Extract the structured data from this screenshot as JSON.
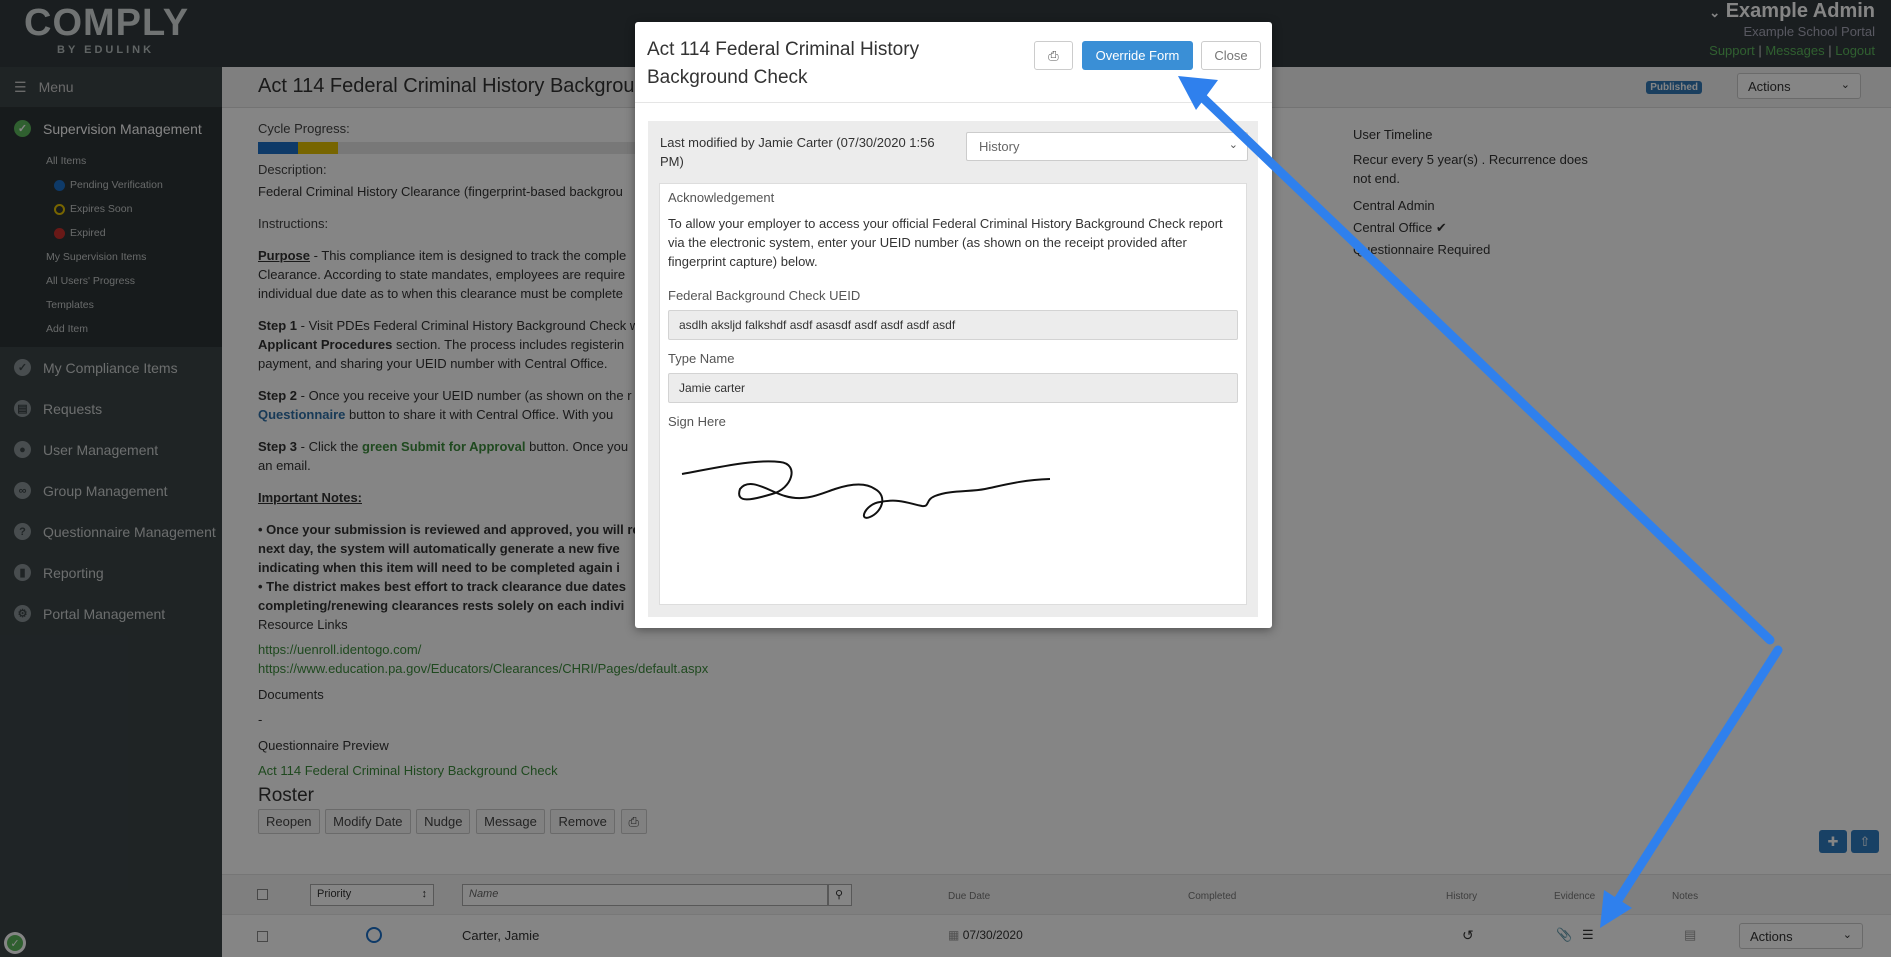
{
  "header": {
    "logo": "COMPLY",
    "logo_by": "BY EDULINK",
    "user_name": "Example Admin",
    "portal_name": "Example School Portal",
    "links": [
      "Support",
      "Messages",
      "Logout"
    ],
    "separator": "|"
  },
  "sidebar": {
    "menu_label": "Menu",
    "items": [
      {
        "label": "Supervision Management",
        "icon": "check-circle-icon"
      },
      {
        "label": "My Compliance Items",
        "icon": "check-circle-icon"
      },
      {
        "label": "Requests",
        "icon": "document-icon"
      },
      {
        "label": "User Management",
        "icon": "user-icon"
      },
      {
        "label": "Group Management",
        "icon": "group-icon"
      },
      {
        "label": "Questionnaire Management",
        "icon": "question-icon"
      },
      {
        "label": "Reporting",
        "icon": "chart-icon"
      },
      {
        "label": "Portal Management",
        "icon": "gear-icon"
      }
    ],
    "sub_items": {
      "all_items": "All Items",
      "pending": "Pending Verification",
      "expires_soon": "Expires Soon",
      "expired": "Expired",
      "my_supervision": "My Supervision Items",
      "all_users_progress": "All Users' Progress",
      "templates": "Templates",
      "add_item": "Add Item"
    },
    "colors": {
      "pending": "#1b6fc7",
      "expires_soon": "#e5c100",
      "expired": "#c9302c"
    }
  },
  "main": {
    "title": "Act 114 Federal Criminal History Backgroun",
    "status_badge": "Published",
    "actions_label": "Actions",
    "cycle_progress_label": "Cycle Progress:",
    "description_label": "Description:",
    "description_text": "Federal Criminal History Clearance (fingerprint-based backgrou",
    "instructions_label": "Instructions:",
    "purpose_label": "Purpose",
    "purpose_text": " - This compliance item is designed to track the comple",
    "purpose_line2": "Clearance.  According to state mandates, employees are require",
    "purpose_line3": "individual due date as to when this clearance must be complete",
    "step1_label": "Step 1",
    "step1_text": " - Visit PDEs Federal Criminal History Background Check w",
    "step1_bold": "Applicant Procedures",
    "step1_line2": " section.  The process includes registerin",
    "step1_line3": "payment, and sharing your UEID number with Central Office.",
    "step2_label": "Step 2",
    "step2_text": " - Once you receive your UEID number (as shown on the r",
    "step2_link": "Questionnaire",
    "step2_line2": " button to share it with Central Office.  With you",
    "step3_label": "Step 3",
    "step3_pre": " - Click the ",
    "step3_link": "green Submit for Approval",
    "step3_post": " button.  Once you",
    "step3_line2": "an email.",
    "important_label": "Important Notes:",
    "note1_line1": "Once your submission is reviewed and approved, you will re",
    "note1_line2": "next day, the system will automatically generate a new five",
    "note1_line3": "indicating when this item will need to be completed again i",
    "note2_line1": "The district makes best effort to track clearance due dates",
    "note2_line2": "completing/renewing clearances rests solely on each indivi",
    "resource_links_label": "Resource Links",
    "resource_links": [
      "https://uenroll.identogo.com/",
      "https://www.education.pa.gov/Educators/Clearances/CHRI/Pages/default.aspx"
    ],
    "documents_label": "Documents",
    "documents_value": "-",
    "questionnaire_preview_label": "Questionnaire Preview",
    "questionnaire_preview_link": "Act 114 Federal Criminal History Background Check",
    "roster_label": "Roster",
    "roster_buttons": [
      "Reopen",
      "Modify Date",
      "Nudge",
      "Message",
      "Remove"
    ]
  },
  "right_col": {
    "timeline_label": "User Timeline",
    "recurrence": "Recur every 5 year(s) . Recurrence does not end.",
    "central_admin": "Central Admin",
    "central_office": "Central Office",
    "questionnaire_required": "Questionnaire Required"
  },
  "table": {
    "priority_placeholder": "Priority",
    "name_placeholder": "Name",
    "columns": [
      "Due Date",
      "Completed",
      "History",
      "Evidence",
      "Notes"
    ],
    "row": {
      "name": "Carter, Jamie",
      "due_date": "07/30/2020",
      "actions": "Actions"
    }
  },
  "modal": {
    "title": "Act 114 Federal Criminal History Background Check",
    "override_label": "Override Form",
    "close_label": "Close",
    "last_modified": "Last modified by Jamie Carter (07/30/2020 1:56 PM)",
    "history_select": "History",
    "ack_label": "Acknowledgement",
    "ack_text": "To allow your employer to access your official Federal Criminal History Background Check report via the electronic system, enter your UEID number (as shown on the receipt provided after fingerprint capture) below.",
    "ueid_label": "Federal Background Check UEID",
    "ueid_value": "asdlh aksljd falkshdf asdf asasdf asdf asdf asdf asdf",
    "type_name_label": "Type Name",
    "type_name_value": "Jamie carter",
    "sign_label": "Sign Here"
  },
  "annotations": {
    "arrow_color": "#2f80ed"
  }
}
